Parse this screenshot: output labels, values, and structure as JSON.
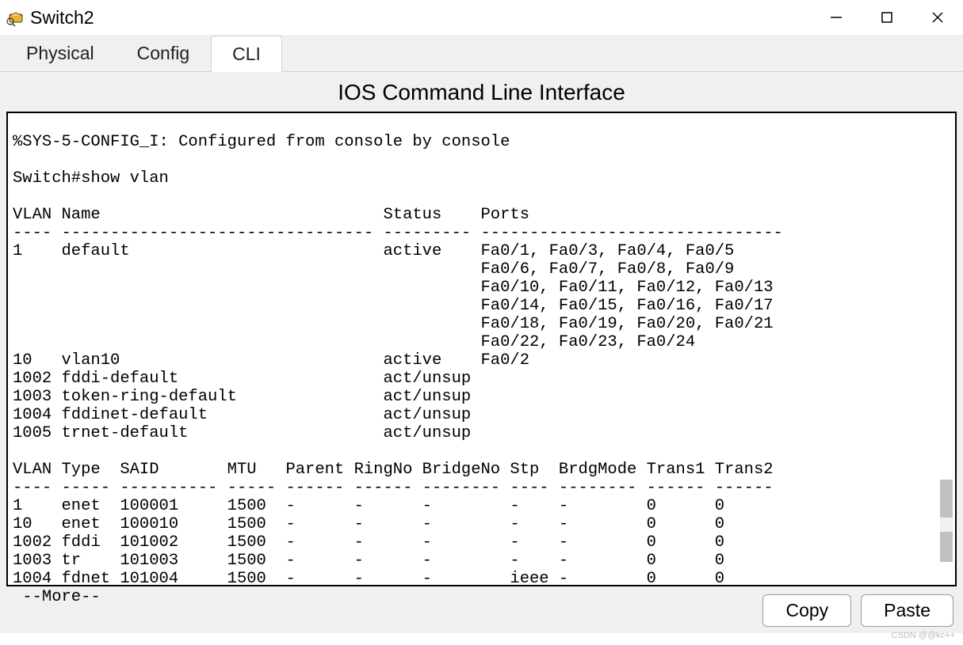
{
  "window": {
    "title": "Switch2"
  },
  "tabs": {
    "items": [
      "Physical",
      "Config",
      "CLI"
    ],
    "active_index": 2
  },
  "cli": {
    "heading": "IOS Command Line Interface",
    "sys_msg": "%SYS-5-CONFIG_I: Configured from console by console",
    "prompt_line": "Switch#show vlan",
    "vlan_basic_header": {
      "c1": "VLAN",
      "c2": "Name",
      "c3": "Status",
      "c4": "Ports"
    },
    "vlan_basic_rule": "---- -------------------------------- --------- -------------------------------",
    "vlan_basic": [
      {
        "id": "1",
        "name": "default",
        "status": "active",
        "ports": [
          "Fa0/1, Fa0/3, Fa0/4, Fa0/5",
          "Fa0/6, Fa0/7, Fa0/8, Fa0/9",
          "Fa0/10, Fa0/11, Fa0/12, Fa0/13",
          "Fa0/14, Fa0/15, Fa0/16, Fa0/17",
          "Fa0/18, Fa0/19, Fa0/20, Fa0/21",
          "Fa0/22, Fa0/23, Fa0/24"
        ]
      },
      {
        "id": "10",
        "name": "vlan10",
        "status": "active",
        "ports": [
          "Fa0/2"
        ]
      },
      {
        "id": "1002",
        "name": "fddi-default",
        "status": "act/unsup",
        "ports": []
      },
      {
        "id": "1003",
        "name": "token-ring-default",
        "status": "act/unsup",
        "ports": []
      },
      {
        "id": "1004",
        "name": "fddinet-default",
        "status": "act/unsup",
        "ports": []
      },
      {
        "id": "1005",
        "name": "trnet-default",
        "status": "act/unsup",
        "ports": []
      }
    ],
    "vlan_detail_header": [
      "VLAN",
      "Type",
      "SAID",
      "MTU",
      "Parent",
      "RingNo",
      "BridgeNo",
      "Stp",
      "BrdgMode",
      "Trans1",
      "Trans2"
    ],
    "vlan_detail_rule": "---- ----- ---------- ----- ------ ------ -------- ---- -------- ------ ------",
    "vlan_detail": [
      {
        "id": "1",
        "type": "enet",
        "said": "100001",
        "mtu": "1500",
        "parent": "-",
        "ringno": "-",
        "bridgeno": "-",
        "stp": "-",
        "brdgmode": "-",
        "trans1": "0",
        "trans2": "0"
      },
      {
        "id": "10",
        "type": "enet",
        "said": "100010",
        "mtu": "1500",
        "parent": "-",
        "ringno": "-",
        "bridgeno": "-",
        "stp": "-",
        "brdgmode": "-",
        "trans1": "0",
        "trans2": "0"
      },
      {
        "id": "1002",
        "type": "fddi",
        "said": "101002",
        "mtu": "1500",
        "parent": "-",
        "ringno": "-",
        "bridgeno": "-",
        "stp": "-",
        "brdgmode": "-",
        "trans1": "0",
        "trans2": "0"
      },
      {
        "id": "1003",
        "type": "tr",
        "said": "101003",
        "mtu": "1500",
        "parent": "-",
        "ringno": "-",
        "bridgeno": "-",
        "stp": "-",
        "brdgmode": "-",
        "trans1": "0",
        "trans2": "0"
      },
      {
        "id": "1004",
        "type": "fdnet",
        "said": "101004",
        "mtu": "1500",
        "parent": "-",
        "ringno": "-",
        "bridgeno": "-",
        "stp": "ieee",
        "brdgmode": "-",
        "trans1": "0",
        "trans2": "0"
      }
    ],
    "more_prompt": " --More--"
  },
  "buttons": {
    "copy": "Copy",
    "paste": "Paste"
  },
  "watermark": "CSDN @@kc++"
}
